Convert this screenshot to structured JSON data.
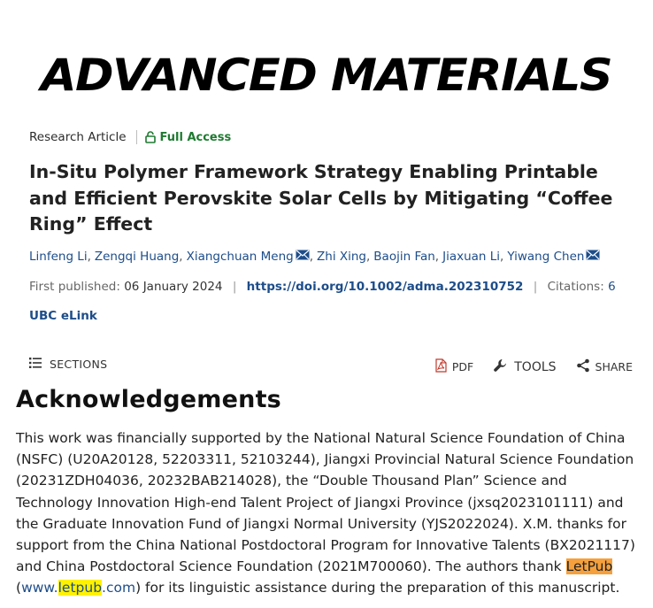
{
  "journal": {
    "name": "ADVANCED MATERIALS"
  },
  "article": {
    "type": "Research Article",
    "access": "Full Access",
    "title": "In-Situ Polymer Framework Strategy Enabling Printable and Efficient Perovskite Solar Cells by Mitigating “Coffee Ring” Effect",
    "authors": [
      "Linfeng Li",
      "Zengqi Huang",
      "Xiangchuan Meng",
      "Zhi Xing",
      "Baojin Fan",
      "Jiaxuan Li",
      "Yiwang Chen"
    ],
    "first_published_label": "First published:",
    "first_published_date": "06 January 2024",
    "doi": "https://doi.org/10.1002/adma.202310752",
    "citations_label": "Citations:",
    "citations_count": "6",
    "elink": "UBC eLink"
  },
  "toolbar": {
    "sections": "SECTIONS",
    "pdf": "PDF",
    "tools": "TOOLS",
    "share": "SHARE"
  },
  "acknowledgements": {
    "heading": "Acknowledgements",
    "body_main": "This work was financially supported by the National Natural Science Foundation of China (NSFC) (U20A20128, 52203311, 52103244), Jiangxi Provincial Natural Science Foundation (20231ZDH04036, 20232BAB214028), the “Double Thousand Plan” Science and Technology Innovation High-end Talent Project of Jiangxi Province (jxsq2023101111) and the Graduate Innovation Fund of Jiangxi Normal University (YJS2022024). X.M. thanks for support from the China National Postdoctoral Program for Innovative Talents (BX2021117) and China Postdoctoral Science Foundation (2021M700060). The authors thank ",
    "letpub": "LetPub",
    "paren_open": "(",
    "link_prefix": "www.",
    "link_highlight": "letpub",
    "link_suffix": ".com",
    "paren_close": ")",
    "body_end": " for its linguistic assistance during the preparation of this manuscript.",
    "highlight_colors": {
      "orange": "#f5a03c",
      "yellow": "#fff200"
    }
  },
  "colors": {
    "link": "#1d4d8a",
    "access_green": "#1e7a30"
  },
  "icons": [
    "lock-icon",
    "mail-icon",
    "sections-list-icon",
    "pdf-icon",
    "wrench-icon",
    "share-icon"
  ]
}
